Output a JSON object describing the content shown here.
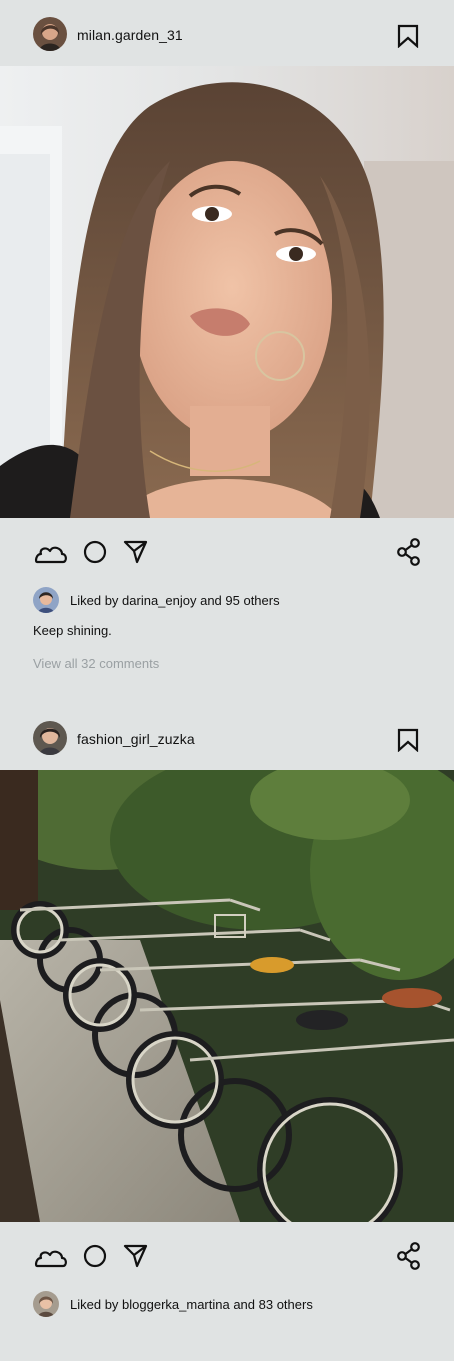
{
  "colors": {
    "background": "#e0e3e3",
    "text": "#111111",
    "muted_text": "#9aa0a3"
  },
  "posts": [
    {
      "username": "milan.garden_31",
      "avatar_icon": "user-avatar-icon",
      "photo_description_icon": "selfie-photo",
      "actions": [
        "cloud-icon",
        "circle-icon",
        "send-icon",
        "share-icon"
      ],
      "liked_by": "Liked by darina_enjoy and 95 others",
      "caption": "Keep shining.",
      "view_comments": "View all 32 comments"
    },
    {
      "username": "fashion_girl_zuzka",
      "avatar_icon": "user-avatar-icon",
      "photo_description_icon": "bicycles-photo",
      "actions": [
        "cloud-icon",
        "circle-icon",
        "send-icon",
        "share-icon"
      ],
      "liked_by": "Liked by bloggerka_martina and 83 others"
    }
  ]
}
